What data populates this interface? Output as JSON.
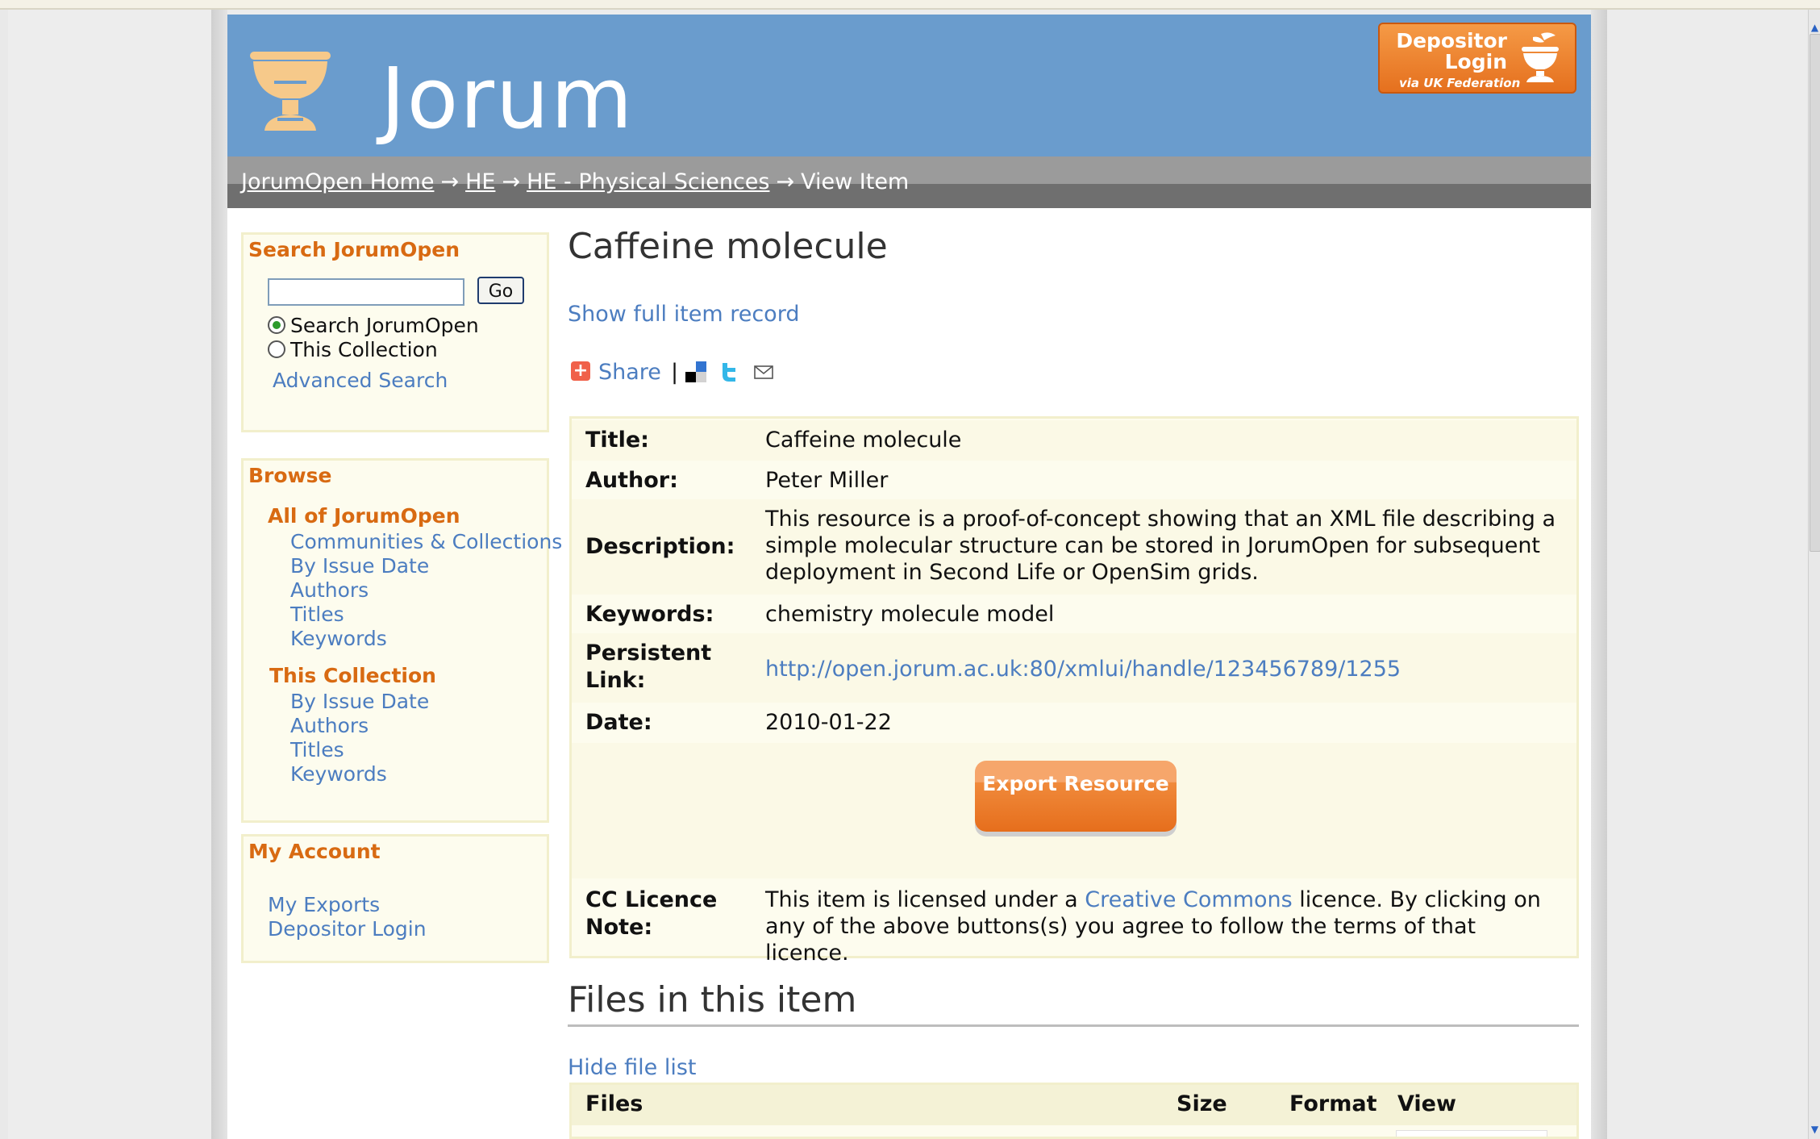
{
  "header": {
    "site_title": "Jorum",
    "depositor_button": {
      "line1": "Depositor",
      "line2": "Login",
      "line3": "via UK Federation"
    }
  },
  "breadcrumb": {
    "items": [
      "JorumOpen Home",
      "HE",
      "HE - Physical Sciences"
    ],
    "current": "View Item",
    "separator": "→"
  },
  "sidebar": {
    "search": {
      "heading": "Search JorumOpen",
      "input_value": "",
      "go_label": "Go",
      "option_all": "Search JorumOpen",
      "option_collection": "This Collection",
      "selected": "Search JorumOpen",
      "advanced_label": "Advanced Search"
    },
    "browse": {
      "heading": "Browse",
      "all_heading": "All of JorumOpen",
      "all_items": [
        "Communities & Collections",
        "By Issue Date",
        "Authors",
        "Titles",
        "Keywords"
      ],
      "collection_heading": "This Collection",
      "collection_items": [
        "By Issue Date",
        "Authors",
        "Titles",
        "Keywords"
      ]
    },
    "account": {
      "heading": "My Account",
      "items": [
        "My Exports",
        "Depositor Login"
      ]
    }
  },
  "item": {
    "title": "Caffeine molecule",
    "show_full_record": "Show full item record",
    "share_label": "Share",
    "share_separator": "|",
    "share_icons": [
      "delicious-icon",
      "twitter-icon",
      "email-icon"
    ],
    "metadata": {
      "title_label": "Title:",
      "title_value": "Caffeine molecule",
      "author_label": "Author:",
      "author_value": "Peter Miller",
      "description_label": "Description:",
      "description_value": "This resource is a proof-of-concept showing that an XML file describing a simple molecular structure can be stored in JorumOpen for subsequent deployment in Second Life or OpenSim grids.",
      "keywords_label": "Keywords:",
      "keywords_value": "chemistry molecule model",
      "link_label": "Persistent Link:",
      "link_value": "http://open.jorum.ac.uk:80/xmlui/handle/123456789/1255",
      "date_label": "Date:",
      "date_value": "2010-01-22",
      "export_button": "Export Resource",
      "licence_label": "CC Licence Note:",
      "licence_prefix": "This item is licensed under a ",
      "licence_link": "Creative Commons",
      "licence_suffix": " licence. By clicking on any of the above buttons(s) you agree to follow the terms of that licence."
    }
  },
  "files": {
    "heading": "Files in this item",
    "hide_label": "Hide file list",
    "columns": [
      "Files",
      "Size",
      "Format",
      "View"
    ]
  },
  "colors": {
    "header_bg": "#6a9ccd",
    "accent_orange": "#d86a12",
    "link_blue": "#4c7dc0",
    "box_bg": "#fdfcee",
    "box_border": "#f2efcc"
  }
}
